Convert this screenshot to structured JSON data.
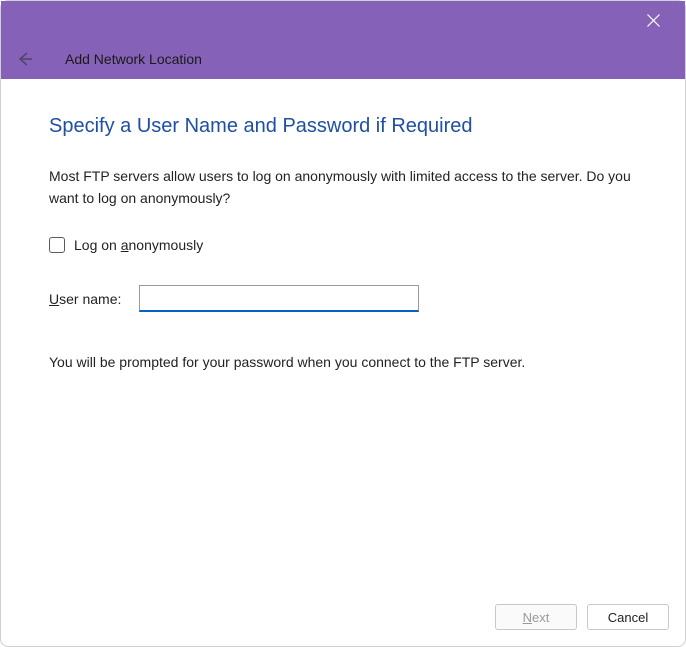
{
  "window": {
    "title": "Add Network Location"
  },
  "page": {
    "heading": "Specify a User Name and Password if Required",
    "description": "Most FTP servers allow users to log on anonymously with limited access to the server.  Do you want to log on anonymously?",
    "checkbox_label_prefix": "Log on ",
    "checkbox_label_underlined": "a",
    "checkbox_label_suffix": "nonymously",
    "checkbox_checked": false,
    "username_label_underlined": "U",
    "username_label_suffix": "ser name:",
    "username_value": "",
    "hint": "You will be prompted for your password when you connect to the FTP server."
  },
  "buttons": {
    "next_underlined": "N",
    "next_suffix": "ext",
    "cancel": "Cancel"
  }
}
